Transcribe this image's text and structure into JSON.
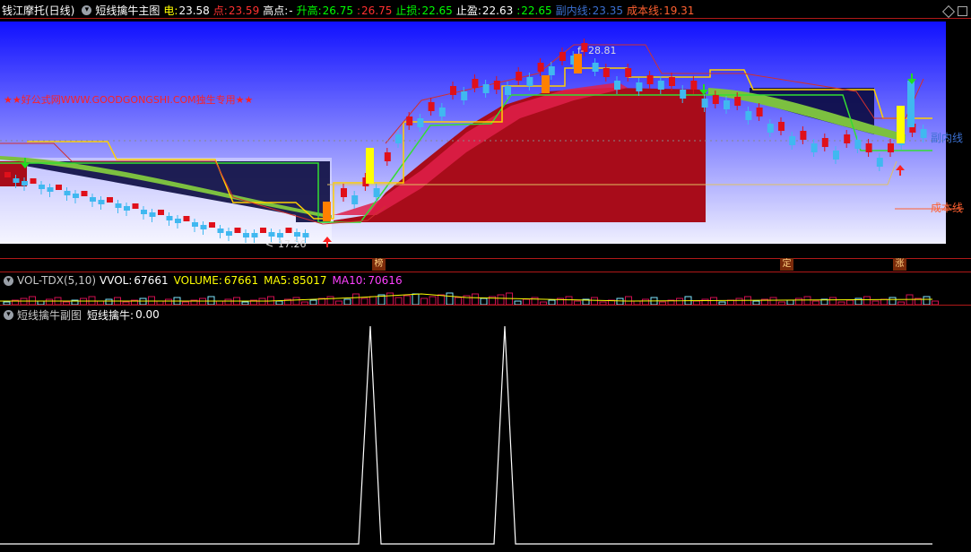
{
  "main_bar": {
    "stock_name": "钱江摩托(日线)",
    "indicator_name": "短线擒牛主图",
    "items": [
      {
        "label": "电:",
        "value": "23.58",
        "label_color": "#ffff00",
        "value_color": "#ffffff"
      },
      {
        "label": "点:",
        "value": "23.59",
        "label_color": "#ff3030",
        "value_color": "#ff3030"
      },
      {
        "label": "高点:",
        "value": "-",
        "label_color": "#ffffff",
        "value_color": "#ffffff"
      },
      {
        "label": "升高:",
        "value": "26.75",
        "label_color": "#00ff00",
        "value_color": "#00ff00"
      },
      {
        "label": ":",
        "value": "26.75",
        "label_color": "#ff3030",
        "value_color": "#ff3030"
      },
      {
        "label": "止损:",
        "value": "22.65",
        "label_color": "#00ff00",
        "value_color": "#00ff00"
      },
      {
        "label": "止盈:",
        "value": "22.63",
        "label_color": "#ffffff",
        "value_color": "#ffffff"
      },
      {
        "label": ":",
        "value": "22.65",
        "label_color": "#00ff00",
        "value_color": "#00ff00"
      },
      {
        "label": "副内线:",
        "value": "23.35",
        "label_color": "#3a6fd0",
        "value_color": "#3a6fd0"
      },
      {
        "label": "成本线:",
        "value": "19.31",
        "label_color": "#ff6030",
        "value_color": "#ff6030"
      }
    ]
  },
  "chart": {
    "watermark": "★★好公式网WWW.GOODGONGSHI.COM独生专用★★",
    "high_label": "28.81",
    "low_label": "17.26",
    "line_label_inner": "副内线",
    "line_label_cost": "成本线",
    "colors": {
      "up": "#e0101a",
      "down": "#40b8f0",
      "sky_top": "#1010ff",
      "sky_bottom": "#f0f0ff",
      "band_red": "#a80c1a",
      "band_green": "#7cc040"
    }
  },
  "markers": [
    {
      "label": "榜"
    },
    {
      "label": "定"
    },
    {
      "label": "涨"
    }
  ],
  "vol_bar": {
    "name": "VOL-TDX(5,10)",
    "items": [
      {
        "label": "VVOL:",
        "value": "67661",
        "color": "#ffffff"
      },
      {
        "label": "VOLUME:",
        "value": "67661",
        "color": "#ffff00"
      },
      {
        "label": "MA5:",
        "value": "85017",
        "color": "#ffff00"
      },
      {
        "label": "MA10:",
        "value": "70616",
        "color": "#ff40ff"
      }
    ]
  },
  "sub_bar": {
    "name": "短线擒牛副图",
    "item_label": "短线擒牛:",
    "item_value": "0.00"
  }
}
